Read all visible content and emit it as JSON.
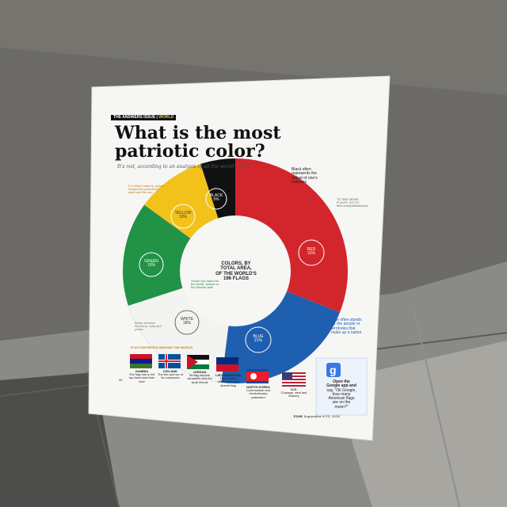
{
  "header": {
    "section_tag": "THE ANSWERS ISSUE",
    "section_world": "WORLD",
    "title_line1": "What is the most",
    "title_line2": "patriotic color?",
    "subtitle": "It's red, according to an analysis of all the world's flags"
  },
  "colors": {
    "red": "#d3262c",
    "blue": "#1f5fb0",
    "white": "#f3f3f1",
    "green": "#219246",
    "yellow": "#f2c21b",
    "black": "#111111"
  },
  "chart_data": {
    "type": "pie",
    "title": "COLORS, BY TOTAL AREA, OF THE WORLD'S 196 FLAGS",
    "categories": [
      "Red",
      "Blue",
      "White",
      "Green",
      "Yellow",
      "Black"
    ],
    "values": [
      31,
      21,
      18,
      15,
      10,
      5
    ],
    "labels": [
      "RED 31%",
      "BLUE 21%",
      "WHITE 18%",
      "GREEN 15%",
      "YELLOW 10%",
      "BLACK 5%"
    ]
  },
  "center_label": {
    "line1": "COLORS, BY",
    "line2": "TOTAL AREA,",
    "line3": "OF THE WORLD'S",
    "line4": "196 FLAGS"
  },
  "wedge_labels": {
    "black_name": "BLACK",
    "black_pct": "5%",
    "yellow_name": "YELLOW",
    "yellow_pct": "10%",
    "red_name": "RED",
    "red_pct": "31%",
    "green_name": "GREEN",
    "green_pct": "15%",
    "blue_name": "BLUE",
    "blue_pct": "21%",
    "white_name": "WHITE",
    "white_pct": "18%"
  },
  "annotations": {
    "black": "Black often represents the defeat of one's enemies",
    "yellow": "For island nations, yellow frequently symbolizes sand and the sun",
    "green": "Green can stand for the Earth, Islamic or the Muslim faith",
    "blue": "Blue often stands for the people or territories that make up a nation",
    "white": "White denotes harmony, unity and peace",
    "see_more": "TO SEE MORE FLAGS, GO TO time.com/patrioticcolor"
  },
  "flags_section": {
    "heading": "FLAG FAVORITES AROUND THE WORLD",
    "flags": [
      {
        "name": "GAMBIA",
        "desc": "The flag has a red top band and blue river"
      },
      {
        "name": "ICELAND",
        "desc": "The fire and ice of its volcanoes"
      },
      {
        "name": "JORDAN",
        "desc": "Its flag depicts dynasties and the Arab Revolt"
      },
      {
        "name": "LIECHTENSTEIN",
        "desc": "The crown's differences in a shared flag"
      },
      {
        "name": "NORTH KOREA",
        "desc": "Communism and revolutionary patriotism"
      },
      {
        "name": "U.S.",
        "desc": "Courage, zeal and bravery"
      }
    ]
  },
  "google_box": {
    "line1": "Open the",
    "line2": "Google app and",
    "line3": "say, \"Ok Google,",
    "line4": "how many",
    "line5": "American flags",
    "line6": "are on the",
    "line7": "moon?\""
  },
  "footer": {
    "page": "44",
    "magazine": "TIME",
    "date": "September 8-15, 2014"
  }
}
